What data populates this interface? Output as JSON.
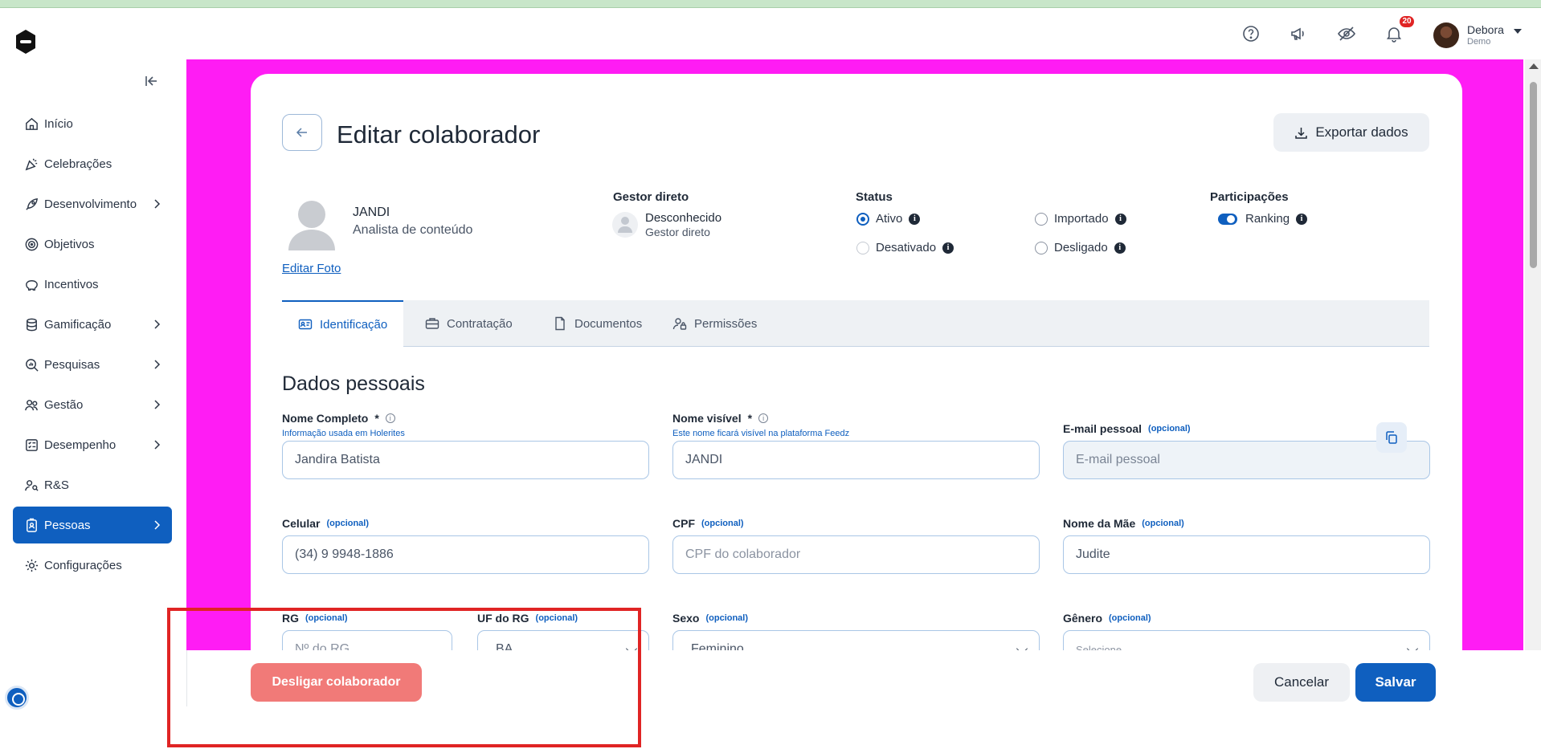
{
  "user": {
    "name": "Debora",
    "role": "Demo",
    "notification_count": "20"
  },
  "sidebar": {
    "items": [
      {
        "label": "Início",
        "icon": "home-icon"
      },
      {
        "label": "Celebrações",
        "icon": "party-icon"
      },
      {
        "label": "Desenvolvimento",
        "icon": "rocket-icon"
      },
      {
        "label": "Objetivos",
        "icon": "target-icon"
      },
      {
        "label": "Incentivos",
        "icon": "piggy-bank-icon"
      },
      {
        "label": "Gamificação",
        "icon": "coins-icon"
      },
      {
        "label": "Pesquisas",
        "icon": "search-chart-icon"
      },
      {
        "label": "Gestão",
        "icon": "people-icon"
      },
      {
        "label": "Desempenho",
        "icon": "checklist-icon"
      },
      {
        "label": "R&S",
        "icon": "people-search-icon"
      },
      {
        "label": "Pessoas",
        "icon": "badge-icon"
      },
      {
        "label": "Configurações",
        "icon": "gear-icon"
      }
    ]
  },
  "page": {
    "title": "Editar colaborador",
    "export_label": "Exportar dados"
  },
  "employee": {
    "name": "JANDI",
    "role": "Analista de conteúdo",
    "edit_photo": "Editar Foto"
  },
  "manager": {
    "heading": "Gestor direto",
    "name": "Desconhecido",
    "sub": "Gestor direto"
  },
  "status": {
    "heading": "Status",
    "options": [
      {
        "label": "Ativo",
        "selected": true
      },
      {
        "label": "Importado",
        "selected": false
      },
      {
        "label": "Desativado",
        "selected": false
      },
      {
        "label": "Desligado",
        "selected": false
      }
    ]
  },
  "participations": {
    "heading": "Participações",
    "ranking_label": "Ranking",
    "ranking_on": true
  },
  "tabs": [
    {
      "label": "Identificação",
      "active": true
    },
    {
      "label": "Contratação",
      "active": false
    },
    {
      "label": "Documentos",
      "active": false
    },
    {
      "label": "Permissões",
      "active": false
    }
  ],
  "section_title": "Dados pessoais",
  "optional_label": "(opcional)",
  "fields": {
    "nome_completo": {
      "label": "Nome Completo",
      "required": "*",
      "hint": "Informação usada em Holerites",
      "value": "Jandira Batista"
    },
    "nome_visivel": {
      "label": "Nome visível",
      "required": "*",
      "hint": "Este nome ficará visível na plataforma Feedz",
      "value": "JANDI"
    },
    "email": {
      "label": "E-mail pessoal",
      "placeholder": "E-mail pessoal"
    },
    "celular": {
      "label": "Celular",
      "value": "(34) 9 9948-1886"
    },
    "cpf": {
      "label": "CPF",
      "placeholder": "CPF do colaborador"
    },
    "nome_mae": {
      "label": "Nome da Mãe",
      "value": "Judite"
    },
    "rg": {
      "label": "RG",
      "placeholder": "Nº do RG"
    },
    "uf_rg": {
      "label": "UF do RG",
      "value": "BA"
    },
    "sexo": {
      "label": "Sexo",
      "value": "Feminino"
    },
    "genero": {
      "label": "Gênero",
      "placeholder": "Selecione"
    }
  },
  "footer": {
    "dismiss_label": "Desligar colaborador",
    "cancel_label": "Cancelar",
    "save_label": "Salvar"
  },
  "colors": {
    "primary": "#0f5fbf",
    "magenta_bg": "#ff1cf4",
    "danger_soft": "#f17a78",
    "highlight": "#e02424"
  }
}
